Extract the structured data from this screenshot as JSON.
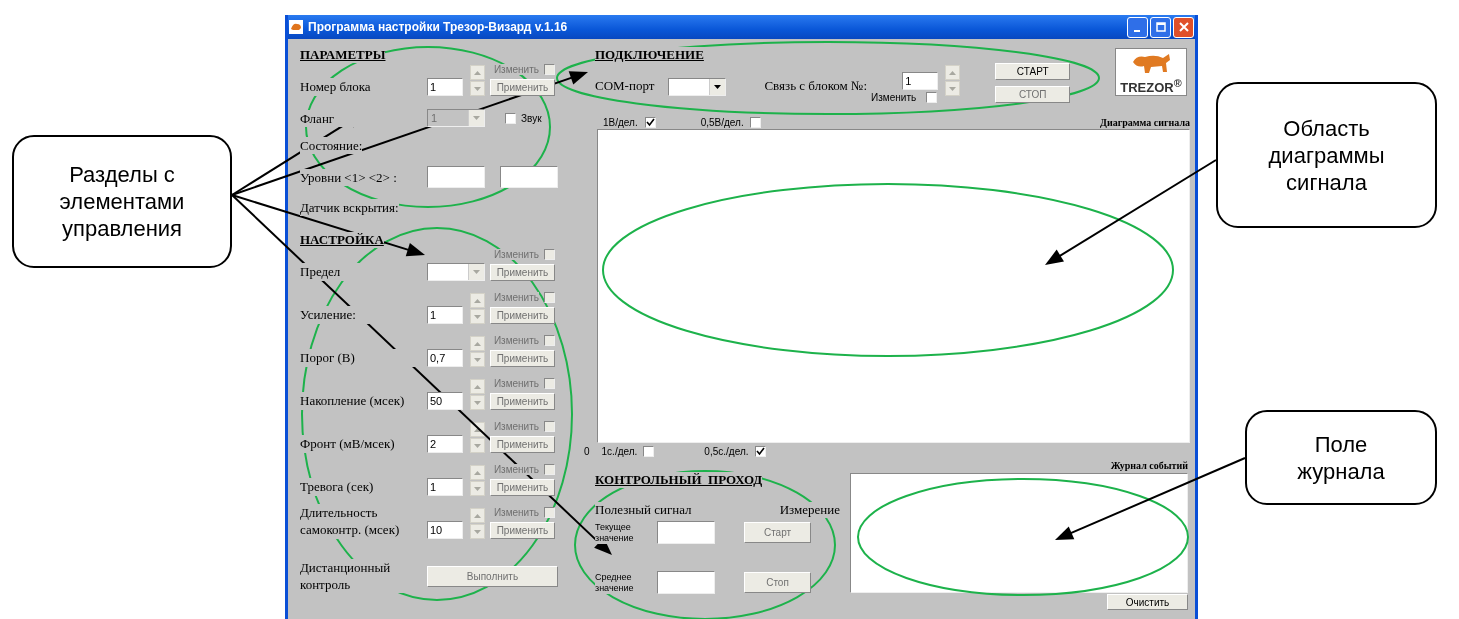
{
  "window": {
    "title": "Программа настройки Трезор-Визард v.1.16"
  },
  "parameters": {
    "heading": "ПАРАМЕТРЫ",
    "rows": [
      {
        "kind": "spin",
        "label": "Номер блока",
        "value": "1",
        "change": {
          "label": "Изменить",
          "checked": false
        },
        "apply": {
          "label": "Применить",
          "disabled": true
        }
      },
      {
        "kind": "combo-sound",
        "label": "Фланг",
        "value": "1",
        "disabled": true,
        "sound": {
          "label": "Звук",
          "checked": false
        }
      },
      {
        "kind": "text",
        "label": "Состояние:"
      },
      {
        "kind": "pair",
        "label": "Уровни <1> <2> :"
      },
      {
        "kind": "text",
        "label": "Датчик вскрытия:"
      }
    ]
  },
  "settings": {
    "heading": "НАСТРОЙКА",
    "rows": [
      {
        "kind": "combo",
        "label": "Предел",
        "change": {
          "label": "Изменить",
          "checked": false
        },
        "apply": {
          "label": "Применить",
          "disabled": true
        }
      },
      {
        "kind": "spin",
        "label": "Усиление:",
        "value": "1",
        "change": {
          "label": "Изменить",
          "checked": false
        },
        "apply": {
          "label": "Применить",
          "disabled": true
        }
      },
      {
        "kind": "spin",
        "label": "Порог (В)",
        "value": "0,7",
        "change": {
          "label": "Изменить",
          "checked": false
        },
        "apply": {
          "label": "Применить",
          "disabled": true
        }
      },
      {
        "kind": "spin",
        "label": "Накопление (мсек)",
        "value": "50",
        "change": {
          "label": "Изменить",
          "checked": false
        },
        "apply": {
          "label": "Применить",
          "disabled": true
        }
      },
      {
        "kind": "spin",
        "label": "Фронт (мВ/мсек)",
        "value": "2",
        "change": {
          "label": "Изменить",
          "checked": false
        },
        "apply": {
          "label": "Применить",
          "disabled": true
        }
      },
      {
        "kind": "spin",
        "label": "Тревога (сек)",
        "value": "1",
        "change": {
          "label": "Изменить",
          "checked": false
        },
        "apply": {
          "label": "Применить",
          "disabled": true
        }
      },
      {
        "kind": "spin",
        "label": "Длительность самоконтр. (мсек)",
        "value": "10",
        "change": {
          "label": "Изменить",
          "checked": false
        },
        "apply": {
          "label": "Применить",
          "disabled": true
        }
      },
      {
        "kind": "action",
        "label": "Дистанционный контроль",
        "button": {
          "label": "Выполнить",
          "disabled": true
        }
      }
    ]
  },
  "connection": {
    "heading": "ПОДКЛЮЧЕНИЕ",
    "port_label": "COM-порт",
    "link_label": "Связь с блоком №:",
    "link_value": "1",
    "change": {
      "label": "Изменить",
      "checked": false
    },
    "buttons": [
      {
        "label": "СТАРТ",
        "disabled": false
      },
      {
        "label": "СТОП",
        "disabled": true
      }
    ],
    "logo": "TREZOR$^{®}$"
  },
  "chart": {
    "title": "Диаграмма сигнала",
    "v_scales": [
      {
        "label": "1В/дел.",
        "checked": true
      },
      {
        "label": "0,5В/дел.",
        "checked": false
      }
    ],
    "origin": "0",
    "t_scales": [
      {
        "label": "1с./дел.",
        "checked": false
      },
      {
        "label": "0,5с./дел.",
        "checked": true
      }
    ]
  },
  "control_pass": {
    "heading": "КОНТРОЛЬНЫЙ  ПРОХОД",
    "signal_label": "Полезный сигнал",
    "measure_label": "Измерение",
    "rows": [
      {
        "label": "Текущее значение",
        "button": {
          "label": "Старт",
          "disabled": true
        }
      },
      {
        "label": "Среднее значение",
        "button": {
          "label": "Стоп",
          "disabled": true
        }
      }
    ]
  },
  "log": {
    "title": "Журнал событий",
    "clear_button": "Очистить"
  },
  "callouts": [
    {
      "text": "Разделы с элементами управления"
    },
    {
      "text": "Область диаграммы сигнала"
    },
    {
      "text": "Поле журнала"
    }
  ]
}
